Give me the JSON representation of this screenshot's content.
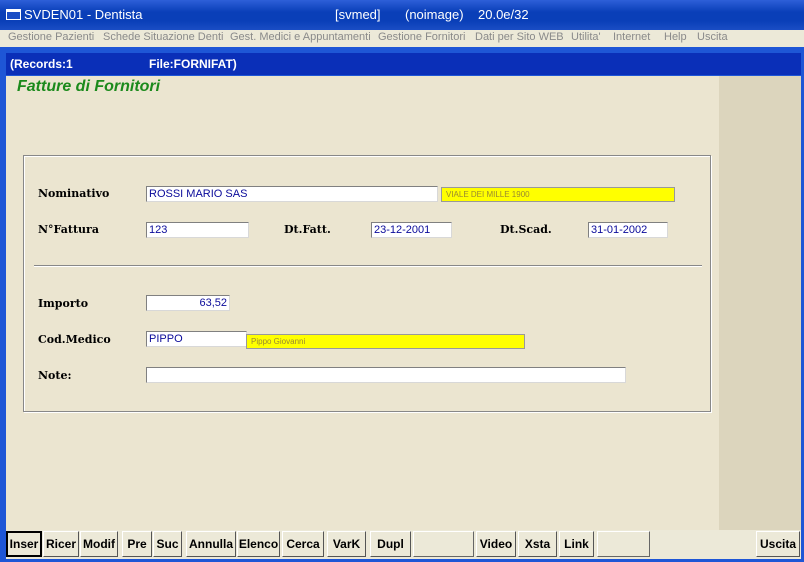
{
  "window": {
    "title": "SVDEN01 - Dentista",
    "center_info": "[svmed]",
    "image_info": "(noimage)",
    "version": "20.0e/32"
  },
  "menu": {
    "items": [
      "Gestione Pazienti",
      "Schede Situazione Denti",
      "Gest. Medici e Appuntamenti",
      "Gestione Fornitori",
      "Dati per Sito WEB",
      "Utilita'",
      "Internet",
      "Help",
      "Uscita"
    ]
  },
  "status": {
    "records": "(Records:1",
    "file": "File:FORNIFAT)"
  },
  "form": {
    "title": "Fatture di Fornitori",
    "labels": {
      "nominativo": "Nominativo",
      "nfattura": "N°Fattura",
      "dtfatt": "Dt.Fatt.",
      "dtscad": "Dt.Scad.",
      "importo": "Importo",
      "codmedico": "Cod.Medico",
      "note": "Note:"
    },
    "values": {
      "nominativo": "ROSSI MARIO SAS",
      "indirizzo": "VIALE DEI MILLE 1900",
      "nfattura": "123",
      "dtfatt": "23-12-2001",
      "dtscad": "31-01-2002",
      "importo": "63,52",
      "codmedico": "PIPPO",
      "medico_nome": "Pippo Giovanni",
      "note": ""
    }
  },
  "buttons": {
    "inser": "Inser",
    "ricer": "Ricer",
    "modif": "Modif",
    "pre": "Pre",
    "suc": "Suc",
    "annulla": "Annulla",
    "elenco": "Elenco",
    "cerca": "Cerca",
    "vark": "VarK",
    "dupl": "Dupl",
    "video": "Video",
    "xsta": "Xsta",
    "link": "Link",
    "uscita": "Uscita"
  }
}
